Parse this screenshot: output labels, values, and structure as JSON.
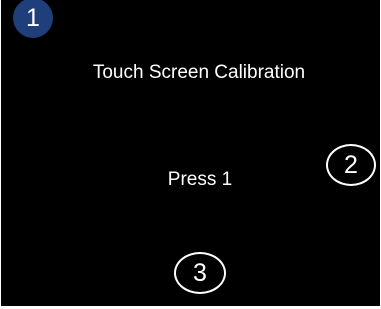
{
  "calibration": {
    "title": "Touch Screen Calibration",
    "prompt": "Press 1",
    "targets": [
      {
        "label": "1",
        "state": "active"
      },
      {
        "label": "2",
        "state": "pending"
      },
      {
        "label": "3",
        "state": "pending"
      }
    ]
  },
  "colors": {
    "background": "#000000",
    "text": "#ffffff",
    "active_target": "#1f3f7a",
    "target_outline": "#ffffff"
  }
}
